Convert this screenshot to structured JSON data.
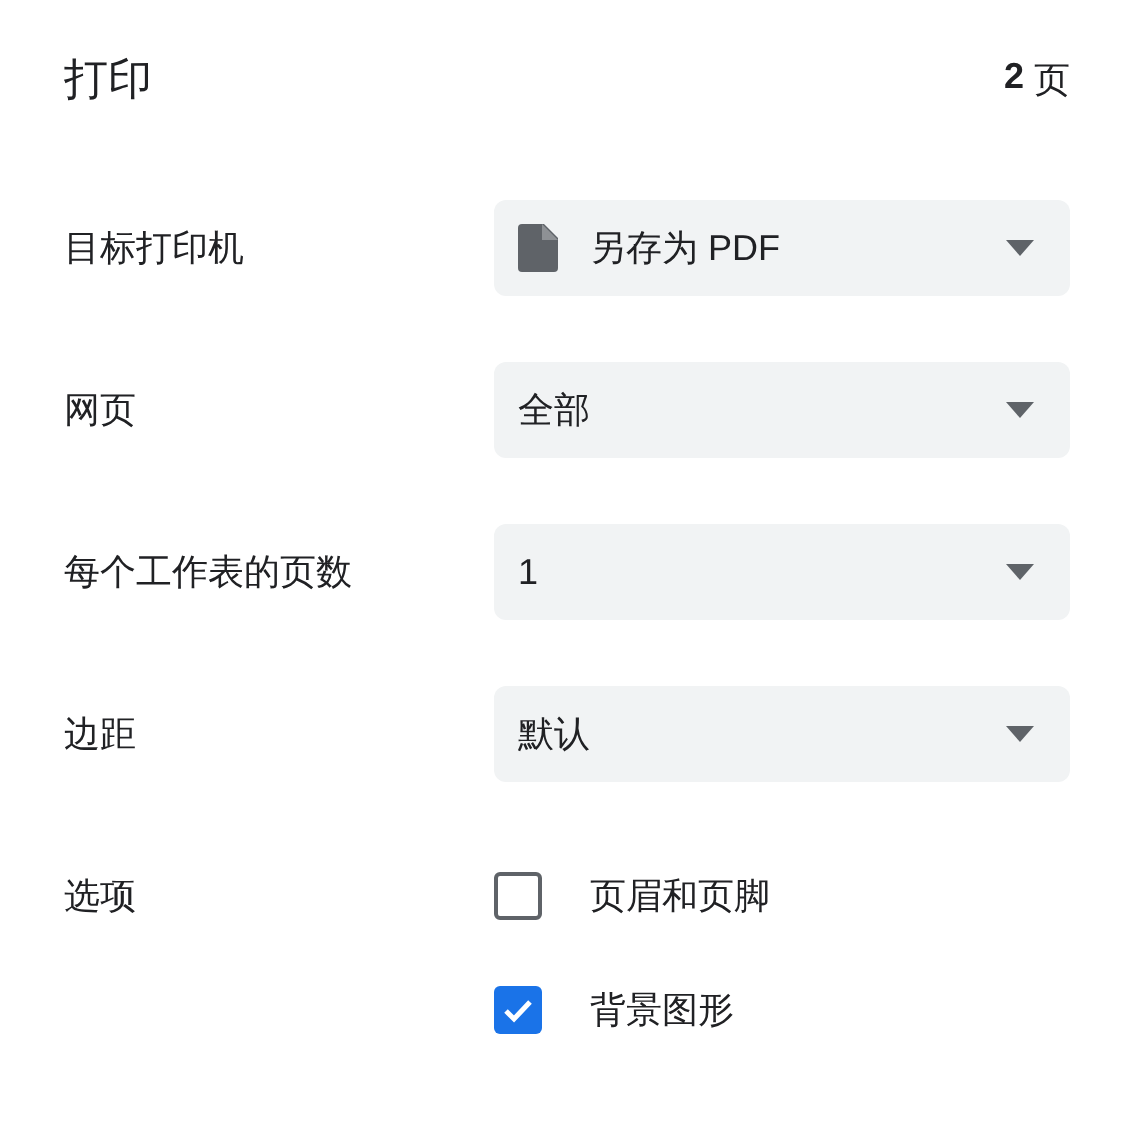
{
  "title": "打印",
  "page_count": {
    "number": "2",
    "unit": "页"
  },
  "settings": [
    {
      "kind": "select",
      "label": "目标打印机",
      "value": "另存为 PDF",
      "has_icon": true
    },
    {
      "kind": "select",
      "label": "网页",
      "value": "全部",
      "has_icon": false
    },
    {
      "kind": "select",
      "label": "每个工作表的页数",
      "value": "1",
      "has_icon": false
    },
    {
      "kind": "select",
      "label": "边距",
      "value": "默认",
      "has_icon": false
    },
    {
      "kind": "checkboxes",
      "label": "选项",
      "options": [
        {
          "label": "页眉和页脚",
          "checked": false
        },
        {
          "label": "背景图形",
          "checked": true
        }
      ]
    }
  ]
}
